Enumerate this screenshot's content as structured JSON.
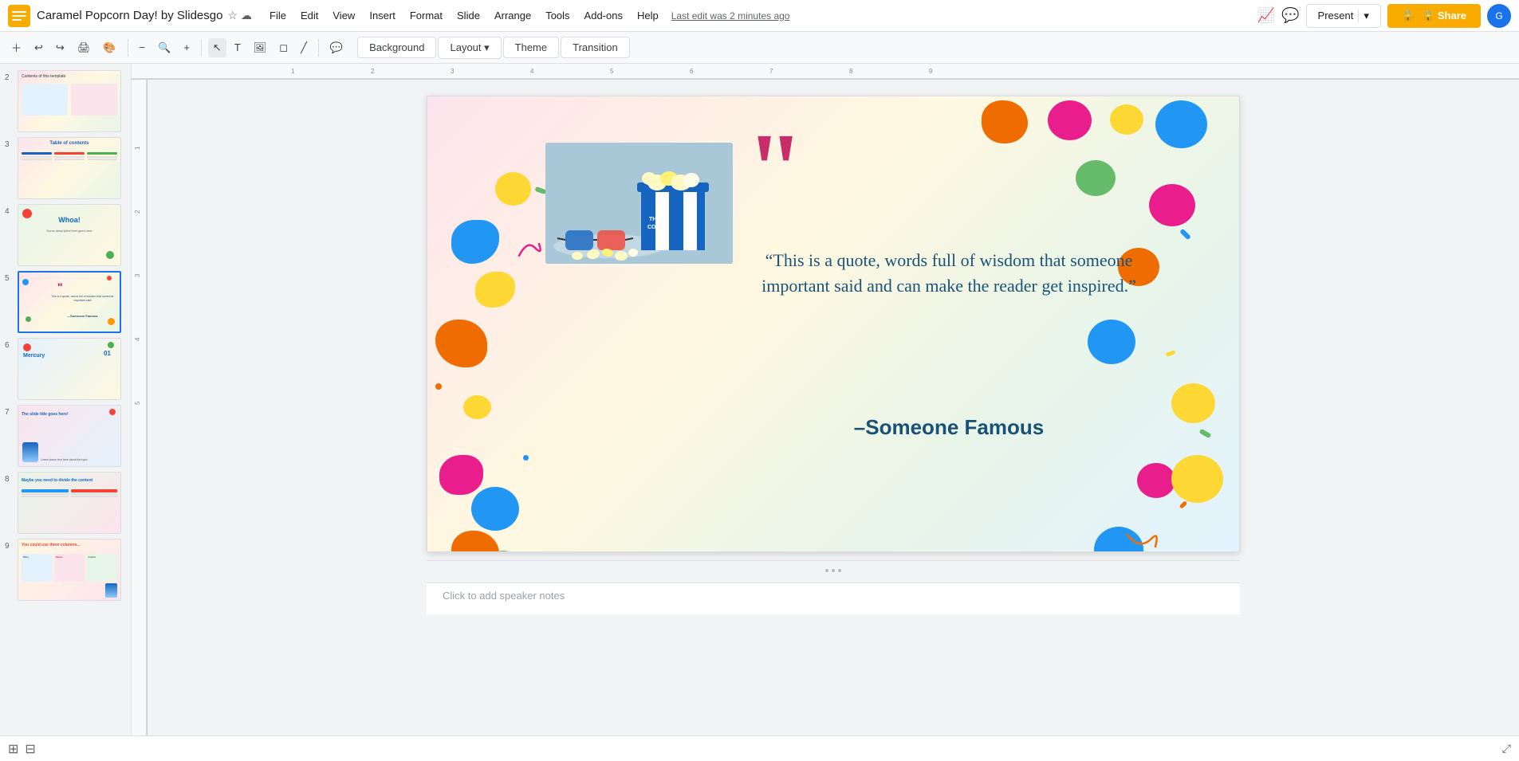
{
  "app": {
    "icon_color": "#f9ab00",
    "title": "Caramel Popcorn Day! by Slidesgo",
    "last_edit": "Last edit was 2 minutes ago"
  },
  "menu": {
    "items": [
      "File",
      "Edit",
      "View",
      "Insert",
      "Format",
      "Slide",
      "Arrange",
      "Tools",
      "Add-ons",
      "Help"
    ]
  },
  "toolbar": {
    "format_bar": {
      "background_label": "Background",
      "layout_label": "Layout",
      "theme_label": "Theme",
      "transition_label": "Transition"
    }
  },
  "top_right": {
    "present_label": "Present",
    "share_label": "🔒 Share"
  },
  "slide": {
    "quote": "“This is a quote, words full of wisdom that someone important said and can make the reader get inspired.”",
    "author": "–Someone Famous"
  },
  "notes": {
    "placeholder": "Click to add speaker notes"
  },
  "slides_panel": {
    "items": [
      {
        "num": "2",
        "label": "Contents slide"
      },
      {
        "num": "3",
        "label": "Table of contents"
      },
      {
        "num": "4",
        "label": "Whoa slide"
      },
      {
        "num": "5",
        "label": "Quote slide",
        "active": true
      },
      {
        "num": "6",
        "label": "Mercury slide"
      },
      {
        "num": "7",
        "label": "Title slide"
      },
      {
        "num": "8",
        "label": "Content divide"
      },
      {
        "num": "9",
        "label": "Three columns"
      }
    ]
  }
}
